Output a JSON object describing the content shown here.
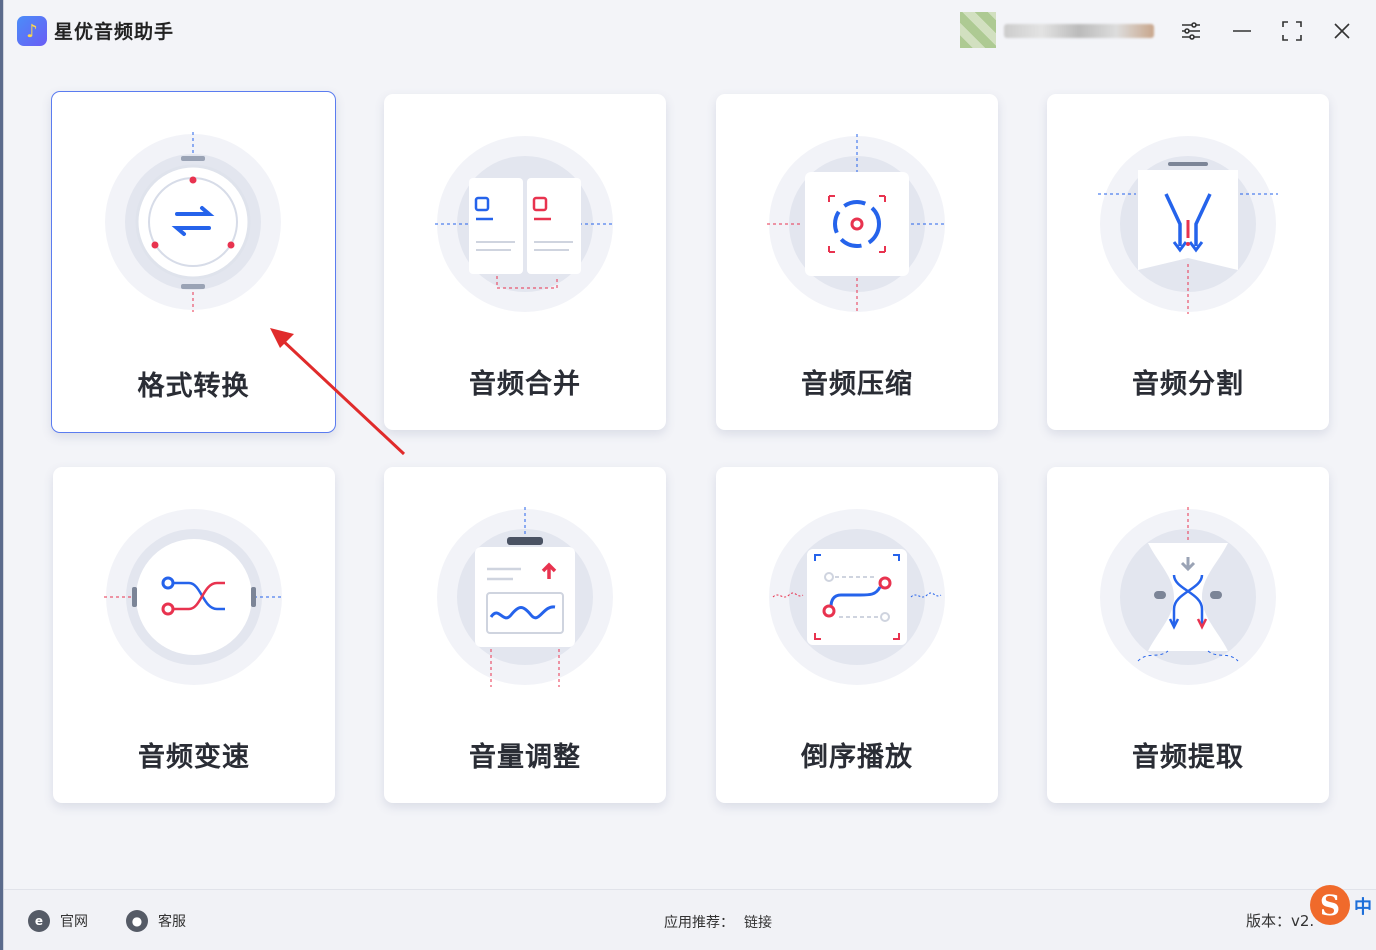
{
  "app": {
    "title": "星优音频助手",
    "logo_glyph": "♪"
  },
  "titlebar": {
    "settings_glyph": "⚙",
    "minimize_glyph": "—",
    "maximize_glyph": "⛶",
    "close_glyph": "✕"
  },
  "features": [
    {
      "label": "格式转换",
      "icon": "format-convert-icon"
    },
    {
      "label": "音频合并",
      "icon": "audio-merge-icon"
    },
    {
      "label": "音频压缩",
      "icon": "audio-compress-icon"
    },
    {
      "label": "音频分割",
      "icon": "audio-split-icon"
    },
    {
      "label": "音频变速",
      "icon": "audio-speed-icon"
    },
    {
      "label": "音量调整",
      "icon": "volume-adjust-icon"
    },
    {
      "label": "倒序播放",
      "icon": "reverse-play-icon"
    },
    {
      "label": "音频提取",
      "icon": "audio-extract-icon"
    }
  ],
  "footer": {
    "website_label": "官网",
    "website_icon_glyph": "e",
    "support_label": "客服",
    "support_icon_glyph": "●",
    "recommend_label": "应用推荐：",
    "recommend_link": "链接",
    "version_label": "版本：v2."
  },
  "ime": {
    "logo": "S",
    "lang": "中"
  },
  "colors": {
    "accent_blue": "#2563eb",
    "accent_red": "#e8334f",
    "selected_border": "#5b7cf0"
  }
}
